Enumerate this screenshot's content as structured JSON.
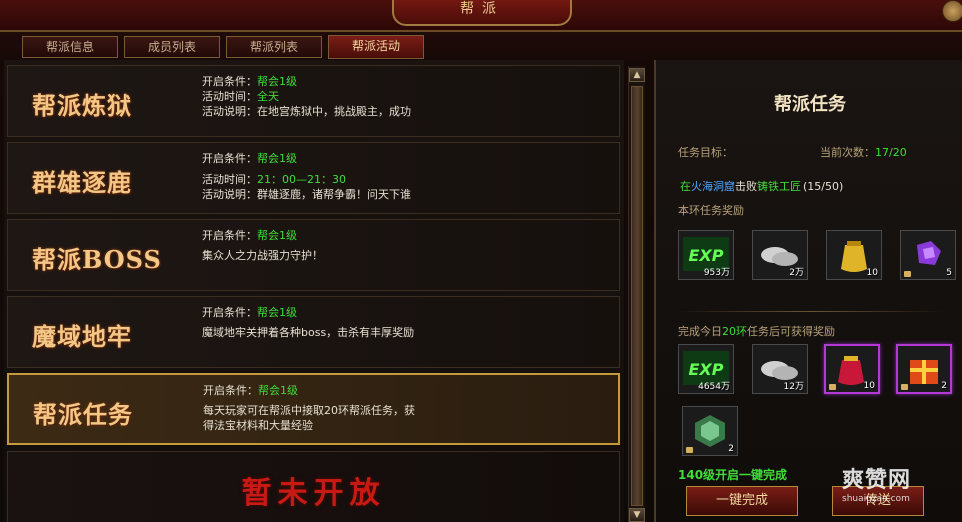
{
  "window": {
    "title": "帮派"
  },
  "tabs": [
    {
      "label": "帮派信息"
    },
    {
      "label": "成员列表"
    },
    {
      "label": "帮派列表"
    },
    {
      "label": "帮派活动"
    }
  ],
  "activities": [
    {
      "name": "帮派炼狱",
      "cond_label": "开启条件：",
      "cond_value": "帮会1级",
      "time_label": "活动时间：",
      "time_value": "全天",
      "desc_label": "活动说明：",
      "desc_value": "在地宫炼狱中，挑战殿主，成功"
    },
    {
      "name": "群雄逐鹿",
      "cond_label": "开启条件：",
      "cond_value": "帮会1级",
      "time_label": "活动时间：",
      "time_value": "21：00—21：30",
      "desc_label": "活动说明：",
      "desc_value": "群雄逐鹿，诸帮争霸！问天下谁"
    },
    {
      "name": "帮派BOSS",
      "cond_label": "开启条件：",
      "cond_value": "帮会1级",
      "desc": "集众人之力战强力守护！"
    },
    {
      "name": "魔域地牢",
      "cond_label": "开启条件：",
      "cond_value": "帮会1级",
      "desc": "魔域地牢关押着各种boss，击杀有丰厚奖励"
    },
    {
      "name": "帮派任务",
      "cond_label": "开启条件：",
      "cond_value": "帮会1级",
      "desc_line1": "每天玩家可在帮派中接取20环帮派任务，获",
      "desc_line2": "得法宝材料和大量经验"
    }
  ],
  "locked_text": "暂未开放",
  "task_panel": {
    "title": "帮派任务",
    "target_label": "任务目标：",
    "count_label": "当前次数：",
    "count_value": "17/20",
    "target_prefix": "在",
    "target_place": "火海洞窟",
    "target_mid": "击败",
    "target_monster": "铸铁工匠",
    "target_progress": "(15/50)",
    "ring_reward_label": "本环任务奖励",
    "ring_rewards": [
      {
        "icon": "exp-icon",
        "count": "953万"
      },
      {
        "icon": "silver-ingot-icon",
        "count": "2万"
      },
      {
        "icon": "gold-pouch-icon",
        "count": "10"
      },
      {
        "icon": "purple-gem-icon",
        "count": "5"
      }
    ],
    "daily_reward_prefix": "完成今日",
    "daily_reward_highlight": "20环",
    "daily_reward_suffix": "任务后可获得奖励",
    "daily_rewards": [
      {
        "icon": "exp-icon",
        "count": "4654万"
      },
      {
        "icon": "silver-ingot-icon",
        "count": "12万"
      },
      {
        "icon": "red-pouch-icon",
        "count": "10"
      },
      {
        "icon": "gift-box-icon",
        "count": "2"
      },
      {
        "icon": "jade-token-icon",
        "count": "2"
      }
    ],
    "one_click_note": "140级开启一键完成",
    "one_click_button": "一键完成",
    "teleport_button": "传送"
  },
  "watermark": {
    "main": "爽赞网",
    "sub": "shuaigzan.com"
  },
  "colors": {
    "accent_gold": "#f3c786",
    "green": "#3fdd3a",
    "blue": "#4fa6ff",
    "locked_red": "#c81a14"
  }
}
